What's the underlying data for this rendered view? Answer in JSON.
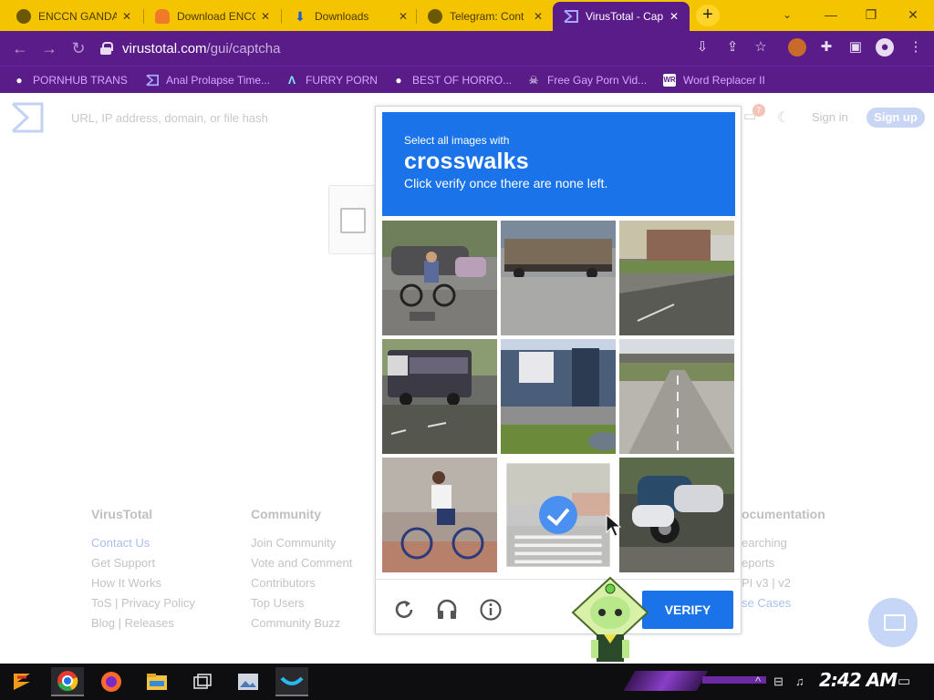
{
  "browser": {
    "tabs": [
      {
        "title": "ENCCN GANDA",
        "favicon": "globe-icon",
        "active": false
      },
      {
        "title": "Download ENCC",
        "favicon": "cloud-icon",
        "active": false
      },
      {
        "title": "Downloads",
        "favicon": "download-icon",
        "active": false
      },
      {
        "title": "Telegram: Cont",
        "favicon": "globe-icon",
        "active": false
      },
      {
        "title": "VirusTotal - Cap",
        "favicon": "virustotal-icon",
        "active": true
      }
    ],
    "new_tab_label": "+",
    "window_controls": {
      "minimize": "—",
      "restore": "❐",
      "close": "✕"
    },
    "address": {
      "host": "virustotal.com",
      "path": "/gui/captcha"
    },
    "bookmarks": [
      {
        "label": "PORNHUB TRANS",
        "icon": "globe-icon"
      },
      {
        "label": "Anal Prolapse Time...",
        "icon": "virustotal-icon"
      },
      {
        "label": "FURRY PORN",
        "icon": "caret-logo-icon"
      },
      {
        "label": "BEST OF HORRO...",
        "icon": "globe-icon"
      },
      {
        "label": "Free Gay Porn Vid...",
        "icon": "skull-icon"
      },
      {
        "label": "Word Replacer II",
        "icon": "wr-icon"
      }
    ]
  },
  "virustotal": {
    "search_placeholder": "URL, IP address, domain, or file hash",
    "notification_count": "7",
    "sign_in": "Sign in",
    "sign_up": "Sign up",
    "footer": [
      {
        "heading": "VirusTotal",
        "links": [
          "Contact Us",
          "Get Support",
          "How It Works",
          "ToS | Privacy Policy",
          "Blog | Releases"
        ]
      },
      {
        "heading": "Community",
        "links": [
          "Join Community",
          "Vote and Comment",
          "Contributors",
          "Top Users",
          "Community Buzz"
        ]
      },
      {
        "heading": "ocumentation",
        "links": [
          "earching",
          "eports",
          "PI v3 | v2",
          "se Cases"
        ]
      }
    ]
  },
  "captcha": {
    "instruction_line1": "Select all images with",
    "keyword": "crosswalks",
    "instruction_line3": "Click verify once there are none left.",
    "tiles": [
      {
        "subject": "cyclist-street",
        "selected": false
      },
      {
        "subject": "truck-road",
        "selected": false
      },
      {
        "subject": "road-building",
        "selected": false
      },
      {
        "subject": "bus-road",
        "selected": false
      },
      {
        "subject": "house-porch",
        "selected": false
      },
      {
        "subject": "highway-overpass",
        "selected": false
      },
      {
        "subject": "cyclist-rubble",
        "selected": false
      },
      {
        "subject": "crosswalk-street",
        "selected": true
      },
      {
        "subject": "motorcycles",
        "selected": false
      }
    ],
    "verify_label": "VERIFY",
    "accent": "#1a73e8"
  },
  "taskbar": {
    "clock": "2:42 AM",
    "apps": [
      "start-icon",
      "chrome-icon",
      "firefox-icon",
      "file-explorer-icon",
      "task-view-icon",
      "photo-viewer-icon",
      "wave-app-icon"
    ]
  },
  "colors": {
    "tabstrip": "#f5c400",
    "theme_purple": "#5a1c88",
    "bookmark_text": "#d7a6ff"
  }
}
